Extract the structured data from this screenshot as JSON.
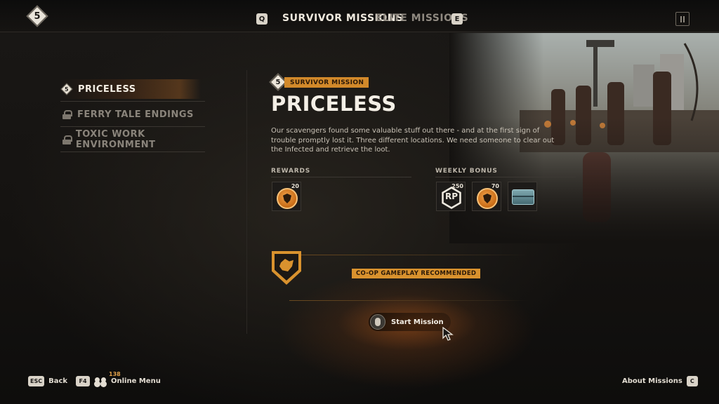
{
  "header": {
    "player_level": "5",
    "left_key": "Q",
    "right_key": "E",
    "tabs": [
      {
        "label": "SURVIVOR MISSIONS",
        "active": true
      },
      {
        "label": "ELITE MISSIONS",
        "active": false
      }
    ]
  },
  "sidebar": {
    "missions": [
      {
        "label": "PRICELESS",
        "level": "5",
        "state": "selected"
      },
      {
        "label": "FERRY TALE ENDINGS",
        "state": "locked"
      },
      {
        "label": "TOXIC WORK ENVIRONMENT",
        "state": "locked"
      }
    ]
  },
  "mission": {
    "level": "5",
    "type": "SURVIVOR MISSION",
    "title": "PRICELESS",
    "description": "Our scavengers found some valuable stuff out there - and at the first sign of trouble promptly lost it. Three different locations. We need someone to clear out the Infected and retrieve the loot.",
    "rewards_label": "REWARDS",
    "weekly_bonus_label": "WEEKLY BONUS",
    "rewards": [
      {
        "icon": "survivor-token-icon",
        "count": "20"
      }
    ],
    "weekly_bonus": [
      {
        "icon": "rp-icon",
        "label": "RP",
        "count": "250"
      },
      {
        "icon": "survivor-token-icon",
        "count": "70"
      },
      {
        "icon": "supply-chest-icon",
        "count": ""
      }
    ],
    "coop_tag": "CO-OP GAMEPLAY RECOMMENDED",
    "start_label": "Start Mission"
  },
  "footer": {
    "back_key": "ESC",
    "back_label": "Back",
    "online_key": "F4",
    "online_count": "138",
    "online_label": "Online Menu",
    "about_label": "About Missions",
    "about_key": "C"
  },
  "colors": {
    "accent": "#d9922e",
    "background": "#121110",
    "text": "#e4ddd0"
  }
}
